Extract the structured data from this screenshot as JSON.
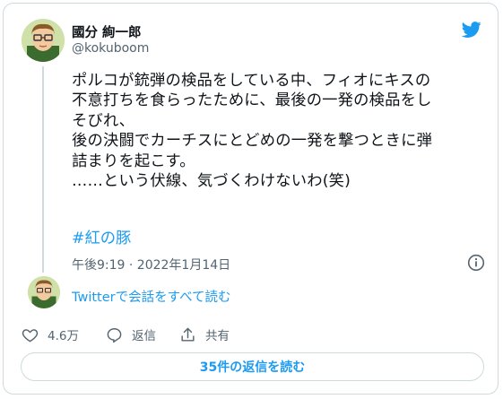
{
  "author": {
    "name": "國分 絢一郎",
    "handle": "@kokuboom"
  },
  "tweet": {
    "text": "ポルコが銃弾の検品をしている中、フィオにキスの\n不意打ちを食らったために、最後の一発の検品をし\nそびれ、\n後の決闘でカーチスにとどめの一発を撃つときに弾\n詰まりを起こす。\n……という伏線、気づくわけないわ(笑)",
    "hashtag": "#紅の豚",
    "timestamp": "午後9:19 · 2022年1月14日"
  },
  "thread": {
    "read_all_label": "Twitterで会話をすべて読む"
  },
  "actions": {
    "likes_count": "4.6万",
    "reply_label": "返信",
    "share_label": "共有"
  },
  "replies_button": {
    "label": "35件の返信を読む"
  },
  "colors": {
    "accent": "#1d9bf0",
    "secondary_text": "#536471",
    "border": "#cfd9de"
  }
}
